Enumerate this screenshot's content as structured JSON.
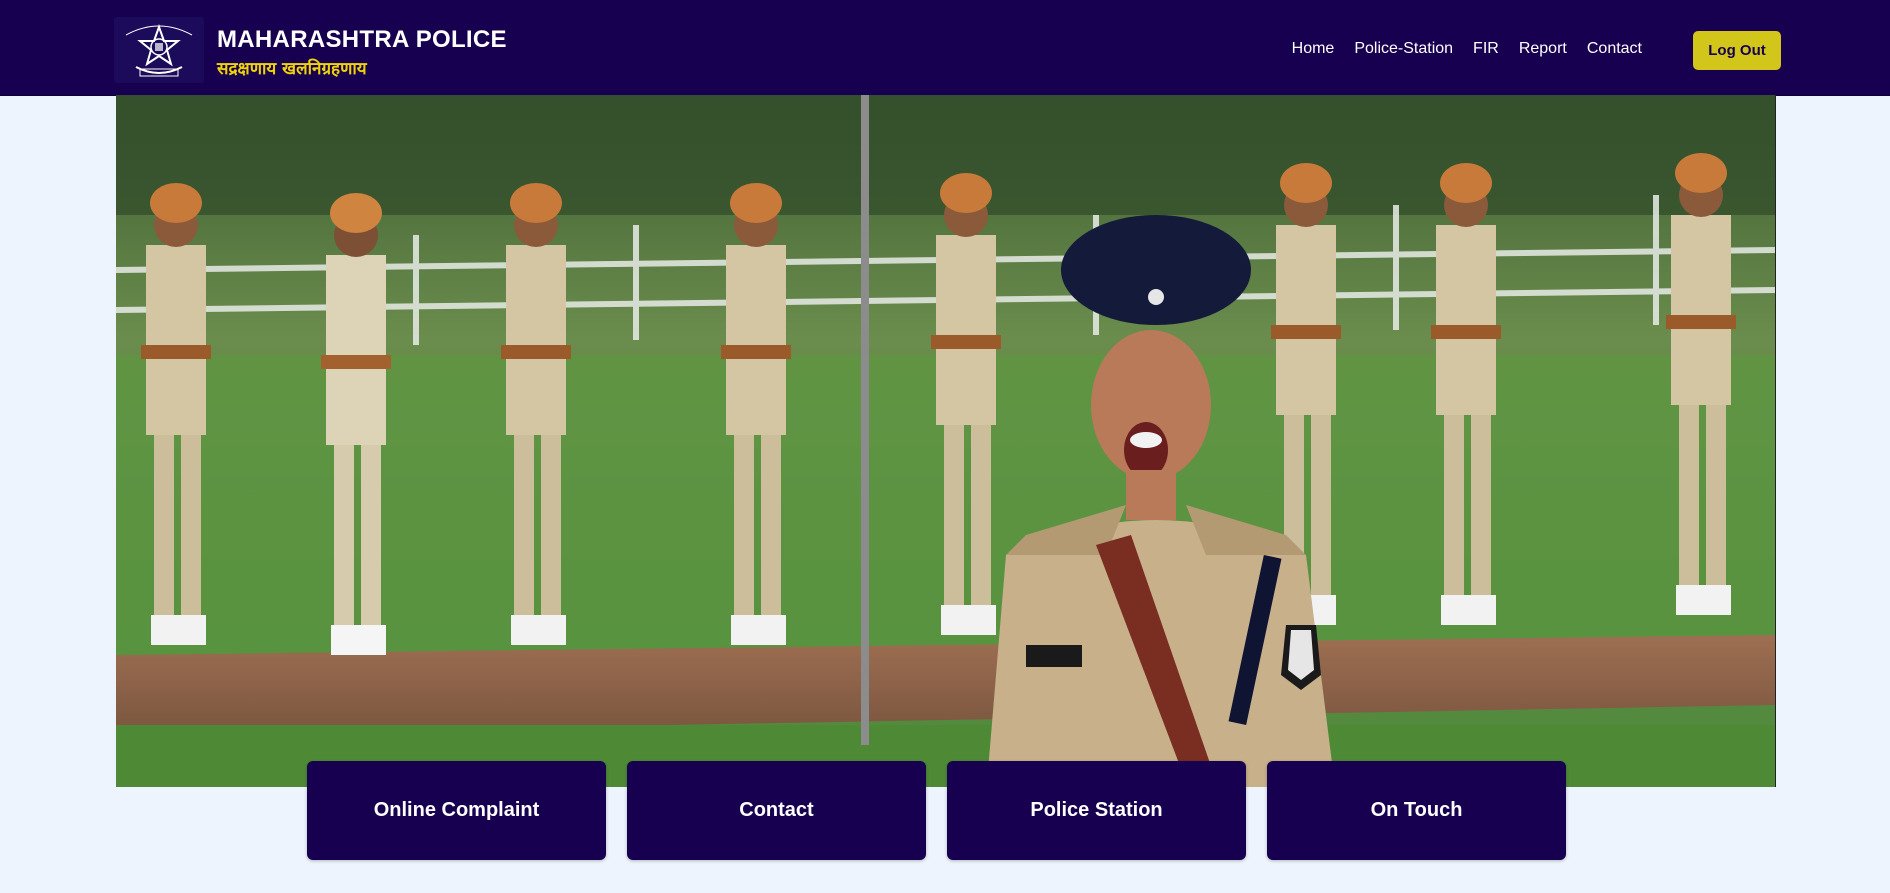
{
  "header": {
    "title": "MAHARASHTRA POLICE",
    "subtitle": "सद्रक्षणाय खलनिग्रहणाय",
    "logo": {
      "icon": "police-emblem-icon",
      "text_top": "महाराष्ट्र पोलीस",
      "text_bottom": "सद्रक्षणाय खलनिग्रहणाय"
    }
  },
  "nav": {
    "items": [
      {
        "label": "Home"
      },
      {
        "label": "Police-Station"
      },
      {
        "label": "FIR"
      },
      {
        "label": "Report"
      },
      {
        "label": "Contact"
      }
    ],
    "logout_label": "Log Out"
  },
  "hero": {
    "image": "police-parade-photo"
  },
  "cards": [
    {
      "label": "Online Complaint"
    },
    {
      "label": "Contact"
    },
    {
      "label": "Police Station"
    },
    {
      "label": "On Touch"
    }
  ],
  "colors": {
    "navbar": "#16004f",
    "accent": "#d2c61a",
    "subtitle": "#f0d20a",
    "background": "#edf4fd",
    "card": "#16004f"
  }
}
